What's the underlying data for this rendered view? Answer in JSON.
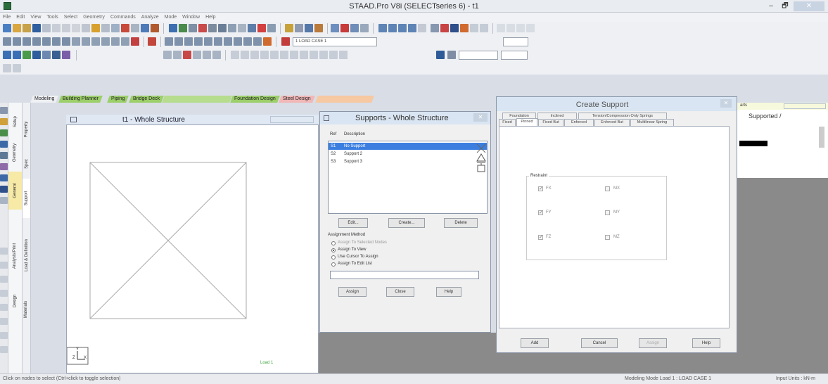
{
  "window": {
    "title": "STAAD.Pro V8i (SELECTseries 6) - t1",
    "controls": {
      "minimize": "–",
      "maximize": "🗗",
      "close": "✕"
    }
  },
  "menubar": [
    "File",
    "Edit",
    "View",
    "Tools",
    "Select",
    "Geometry",
    "Commands",
    "Analyze",
    "Mode",
    "Window",
    "Help"
  ],
  "toolbar": {
    "load_case_combo": "1 LOAD CASE 1"
  },
  "model_tabs": {
    "modeling": "Modeling",
    "building_planner": "Building Planner",
    "piping": "Piping",
    "bridge_deck": "Bridge Deck",
    "foundation_design": "Foundation Design",
    "steel_design": "Steel Design"
  },
  "side_tabs": {
    "setup": "Setup",
    "geometry": "Geometry",
    "general": "General",
    "analysis_print": "Analysis/Print",
    "design": "Design",
    "property": "Property",
    "spec": "Spec",
    "support": "Support",
    "load_definition": "Load & Definition",
    "materials": "Materials"
  },
  "view": {
    "title": "t1 - Whole Structure",
    "load_label": "Load 1",
    "axis_y": "Y",
    "axis_x": "X",
    "axis_z": "Z"
  },
  "supports_dialog": {
    "title": "Supports - Whole Structure",
    "col_ref": "Ref",
    "col_desc": "Description",
    "rows": [
      {
        "ref": "S1",
        "desc": "No Support",
        "selected": true
      },
      {
        "ref": "S2",
        "desc": "Support 2",
        "selected": false
      },
      {
        "ref": "S3",
        "desc": "Support 3",
        "selected": false
      }
    ],
    "edit_btn": "Edit...",
    "create_btn": "Create...",
    "delete_btn": "Delete",
    "assign_method_label": "Assignment Method",
    "radio_selected_nodes": "Assign To Selected Nodes",
    "radio_view": "Assign To View",
    "radio_cursor": "Use Cursor To Assign",
    "radio_edit_list": "Assign To Edit List",
    "edit_list_value": "",
    "assign_btn": "Assign",
    "close_btn": "Close",
    "help_btn": "Help"
  },
  "create_support_dialog": {
    "title": "Create Support",
    "tabs_row1": [
      "Foundation",
      "Inclined",
      "Tension/Compression Only Springs"
    ],
    "tabs_row2": [
      "Fixed",
      "Pinned",
      "Fixed But",
      "Enforced",
      "Enforced But",
      "Multilinear Spring"
    ],
    "active_tab": "Pinned",
    "group_label": "Restraint",
    "restraints": [
      {
        "name": "FX",
        "checked": true
      },
      {
        "name": "MX",
        "checked": false
      },
      {
        "name": "FY",
        "checked": true
      },
      {
        "name": "MY",
        "checked": false
      },
      {
        "name": "FZ",
        "checked": true
      },
      {
        "name": "MZ",
        "checked": false
      }
    ],
    "add_btn": "Add",
    "cancel_btn": "Cancel",
    "assign_btn": "Assign",
    "help_btn": "Help"
  },
  "right_pane": {
    "title_fragment": "Supported /",
    "header_fragment": "arts"
  },
  "status": {
    "left": "Click on nodes to select (Ctrl+click to toggle selection)",
    "mode": "Modeling Mode   Load 1 : LOAD CASE 1",
    "units": "Input Units : kN-m"
  }
}
